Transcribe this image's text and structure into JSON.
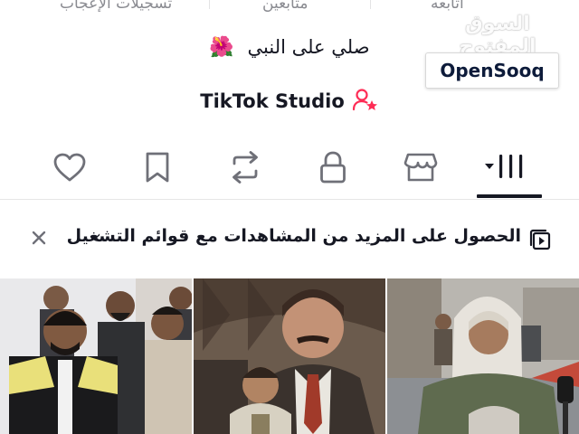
{
  "profile": {
    "stats": {
      "likes_label": "تسجيلات الإعجاب",
      "followers_label": "متابعين",
      "following_label": "أتابعه"
    },
    "bio": "صلي على النبي",
    "bio_emoji": "🌺",
    "studio_label": "TikTok Studio"
  },
  "watermark": {
    "arabic": "السوق المفتوح",
    "brand": "OpenSooq"
  },
  "tabs": [
    {
      "name": "liked",
      "icon": "heart-icon"
    },
    {
      "name": "favorites",
      "icon": "bookmark-icon"
    },
    {
      "name": "reposts",
      "icon": "repost-icon"
    },
    {
      "name": "private",
      "icon": "lock-icon"
    },
    {
      "name": "shop",
      "icon": "shop-icon"
    },
    {
      "name": "videos",
      "icon": "grid-videos-icon",
      "active": true
    }
  ],
  "banner": {
    "text": "الحصول على المزيد من المشاهدات مع قوائم التشغيل",
    "chevron": "‹",
    "close_icon": "close-icon",
    "playlist_icon": "playlist-icon"
  },
  "videos": [
    {
      "name": "video-thumbnail-1"
    },
    {
      "name": "video-thumbnail-2"
    },
    {
      "name": "video-thumbnail-3"
    }
  ]
}
